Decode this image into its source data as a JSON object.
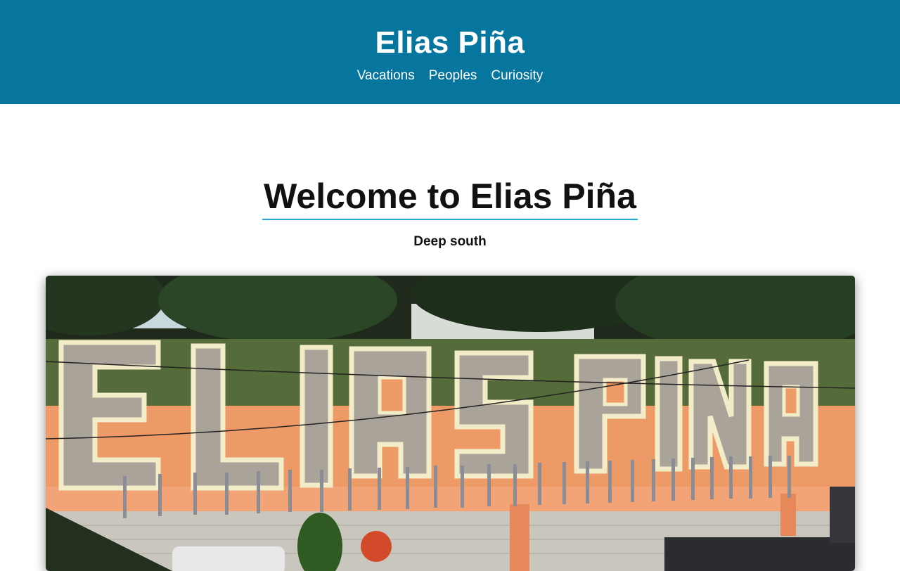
{
  "header": {
    "site_title": "Elias Piña",
    "nav": [
      {
        "label": "Vacations"
      },
      {
        "label": "Peoples"
      },
      {
        "label": "Curiosity"
      }
    ]
  },
  "main": {
    "heading": "Welcome to Elias Piña",
    "subtitle": "Deep south",
    "image": {
      "description": "",
      "sign_text": "ELIAS PIÑA"
    }
  },
  "colors": {
    "header_bg": "#06769f",
    "heading_underline": "#22a6d6",
    "wall_orange": "#ee9a66"
  }
}
